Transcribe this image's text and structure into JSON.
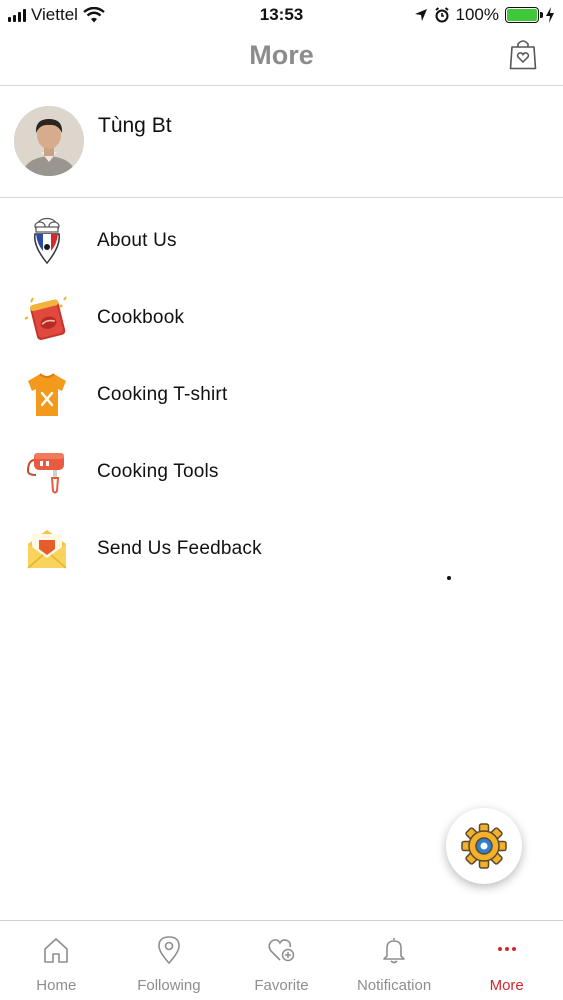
{
  "status_bar": {
    "carrier": "Viettel",
    "time": "13:53",
    "battery": "100%"
  },
  "header": {
    "title": "More"
  },
  "profile": {
    "name": "Tùng Bt"
  },
  "menu": {
    "items": [
      {
        "label": "About Us",
        "icon": "chef-location-pin-icon"
      },
      {
        "label": "Cookbook",
        "icon": "cookbook-icon"
      },
      {
        "label": "Cooking T-shirt",
        "icon": "t-shirt-icon"
      },
      {
        "label": "Cooking Tools",
        "icon": "hand-mixer-icon"
      },
      {
        "label": "Send Us Feedback",
        "icon": "envelope-icon"
      }
    ]
  },
  "tabs": [
    {
      "label": "Home",
      "icon": "home-icon",
      "active": false
    },
    {
      "label": "Following",
      "icon": "location-pin-icon",
      "active": false
    },
    {
      "label": "Favorite",
      "icon": "heart-plus-icon",
      "active": false
    },
    {
      "label": "Notification",
      "icon": "bell-icon",
      "active": false
    },
    {
      "label": "More",
      "icon": "more-dots-icon",
      "active": true
    }
  ],
  "colors": {
    "accent": "#d0282e",
    "title_gray": "#8c8c8c",
    "battery_green": "#3fc93a",
    "gear_yellow": "#f2b02c"
  }
}
